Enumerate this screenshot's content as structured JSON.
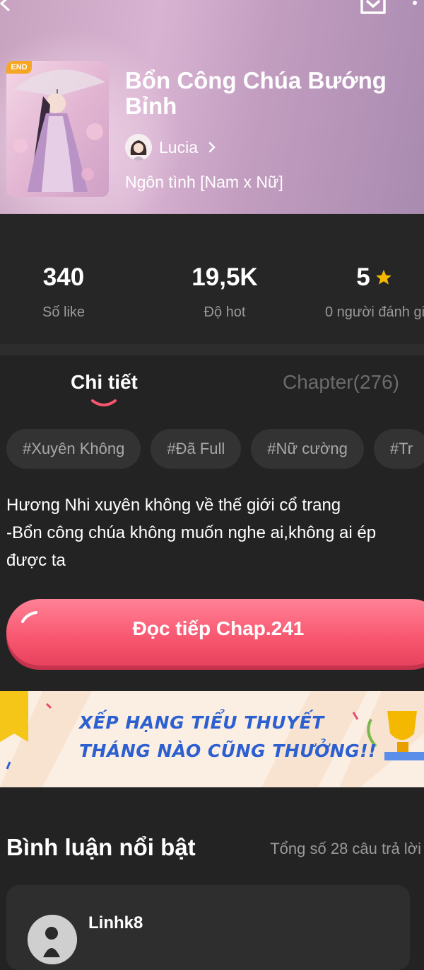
{
  "header": {
    "end_badge": "END",
    "title": "Bổn Công Chúa Bướng Bỉnh",
    "author": "Lucia",
    "genre": "Ngôn tình [Nam x Nữ]"
  },
  "stats": [
    {
      "value": "340",
      "label": "Số like"
    },
    {
      "value": "19,5K",
      "label": "Độ hot"
    },
    {
      "value": "5",
      "label": "0 người đánh gi"
    }
  ],
  "tabs": {
    "detail": "Chi tiết",
    "chapters": "Chapter(276)"
  },
  "tags": [
    "#Xuyên Không",
    "#Đã Full",
    "#Nữ cường",
    "#Tr"
  ],
  "description": [
    "Hương Nhi xuyên không về thế giới cổ trang",
    "-Bổn công chúa không muốn nghe ai,không ai ép",
    "được ta"
  ],
  "read_button": "Đọc tiếp Chap.241",
  "banner": {
    "line1": "XẾP HẠNG TIỂU THUYẾT",
    "line2": "THÁNG NÀO CŨNG THƯỞNG!!"
  },
  "comments": {
    "title": "Bình luận nổi bật",
    "count": "Tổng số 28 câu trả lời",
    "first_user": "Linhk8"
  },
  "colors": {
    "accent": "#f8566f",
    "star": "#f5b800",
    "tab_indicator": "#f8566f"
  }
}
